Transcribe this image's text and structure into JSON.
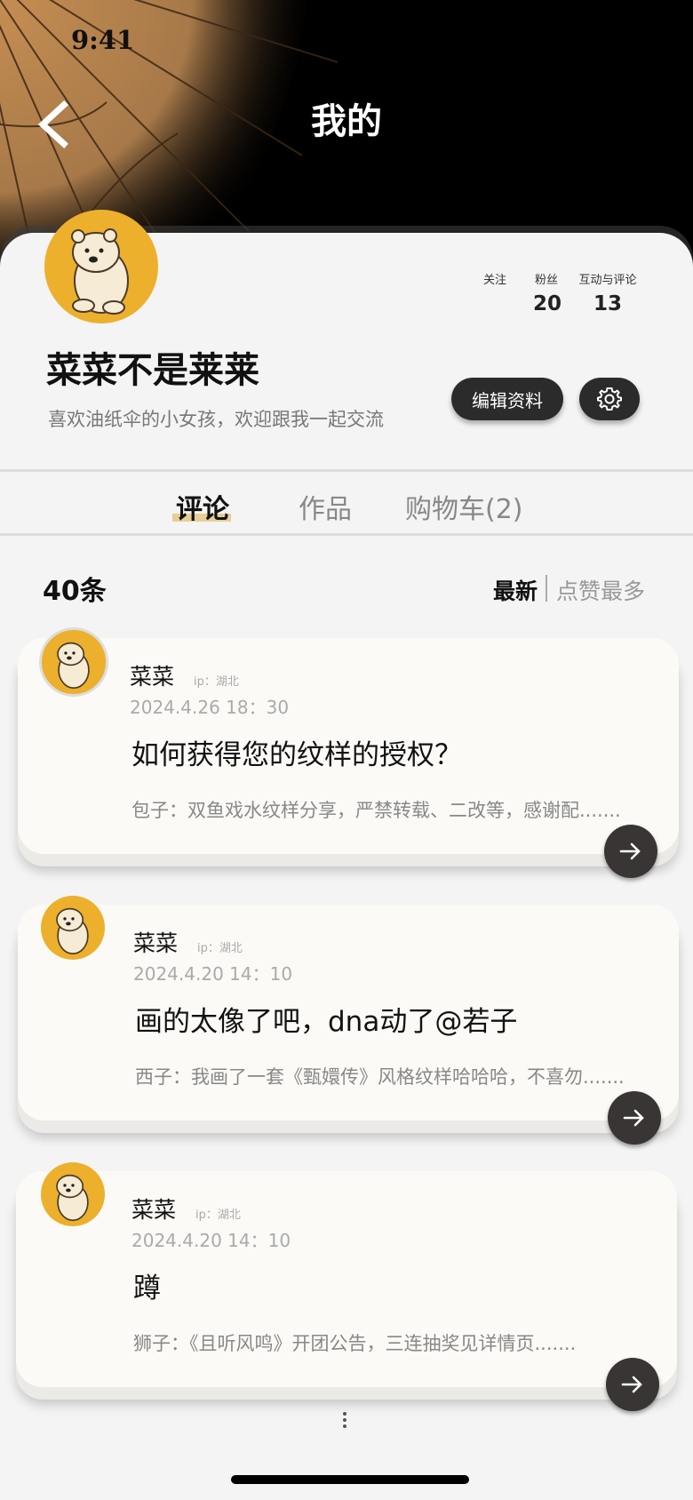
{
  "status_bar": {
    "time": "9:41"
  },
  "header": {
    "title": "我的"
  },
  "profile": {
    "name": "菜菜不是莱莱",
    "bio": "喜欢油纸伞的小女孩，欢迎跟我一起交流",
    "stats": [
      {
        "label": "关注",
        "value": ""
      },
      {
        "label": "粉丝",
        "value": "20"
      },
      {
        "label": "互动与评论",
        "value": "13"
      }
    ],
    "edit_label": "编辑资料"
  },
  "tabs": [
    {
      "label": "评论",
      "active": true
    },
    {
      "label": "作品",
      "active": false
    },
    {
      "label": "购物车(2)",
      "active": false
    }
  ],
  "list": {
    "count_label": "40条",
    "sort_options": [
      "最新",
      "点赞最多"
    ],
    "sort_active": "最新"
  },
  "comments": [
    {
      "author": "菜菜",
      "ip": "ip：湖北",
      "time": "2024.4.26  18：30",
      "text": "如何获得您的纹样的授权？",
      "reply": "包子：双鱼戏水纹样分享，严禁转载、二改等，感谢配......."
    },
    {
      "author": "菜菜",
      "ip": "ip：湖北",
      "time": "2024.4.20  14：10",
      "text": "画的太像了吧，dna动了@若子",
      "reply": "西子：我画了一套《甄嬛传》风格纹样哈哈哈，不喜勿......."
    },
    {
      "author": "菜菜",
      "ip": "ip：湖北",
      "time": "2024.4.20  14：10",
      "text": "蹲",
      "reply": "狮子：《且听风鸣》开团公告，三连抽奖见详情页......."
    }
  ],
  "colors": {
    "accent_underline": "#e6cf95",
    "dark_button": "#2b2b2b",
    "avatar_bg": "#edb02c"
  }
}
